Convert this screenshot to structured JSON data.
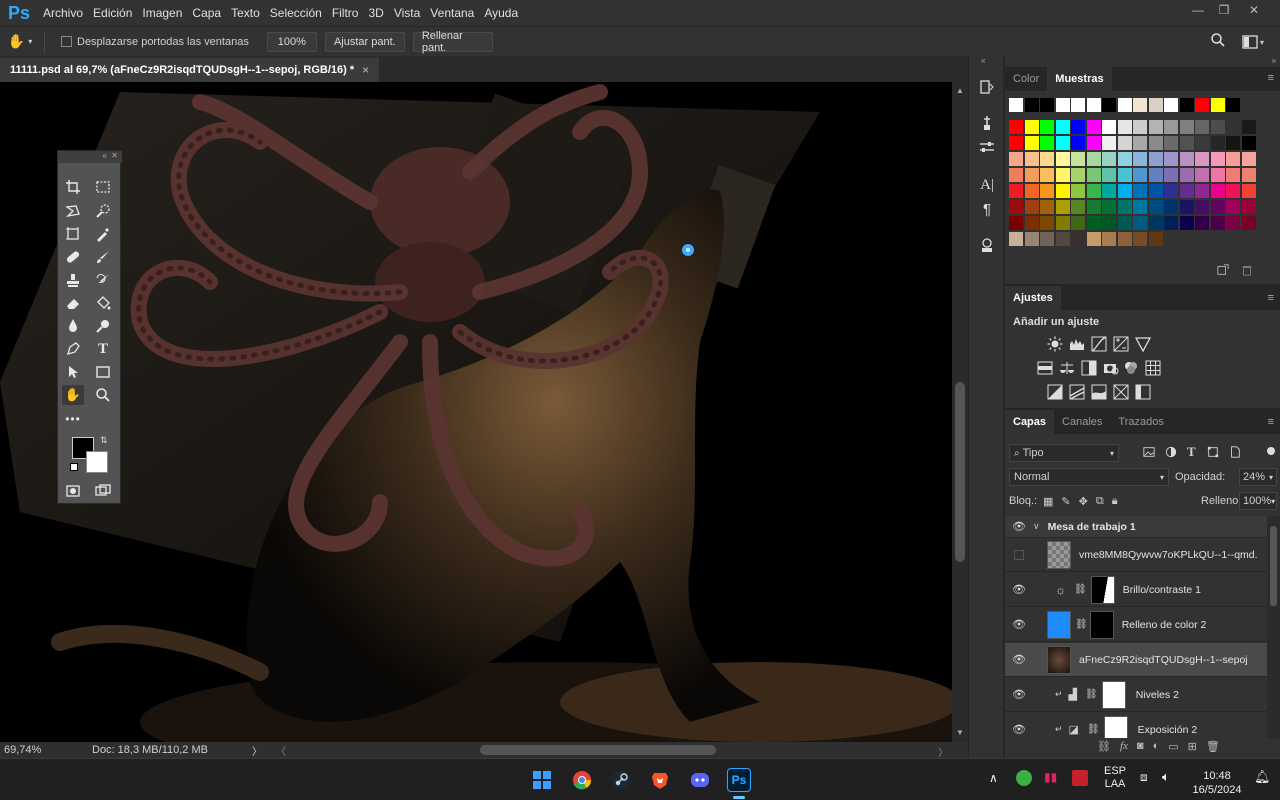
{
  "app": {
    "logo": "Ps"
  },
  "menu": [
    "Archivo",
    "Edición",
    "Imagen",
    "Capa",
    "Texto",
    "Selección",
    "Filtro",
    "3D",
    "Vista",
    "Ventana",
    "Ayuda"
  ],
  "options": {
    "scroll_all_label": "Desplazarse portodas las ventanas",
    "zoom_btn": "100%",
    "fit_btn": "Ajustar pant.",
    "fill_btn": "Rellenar pant."
  },
  "document": {
    "tab_title": "11111.psd al 69,7% (aFneCz9R2isqdTQUDsgH--1--sepoj, RGB/16) *",
    "close_glyph": "×"
  },
  "status": {
    "zoom": "69,74%",
    "doc": "Doc: 18,3 MB/110,2 MB"
  },
  "swatches_panel": {
    "tabs": [
      "Color",
      "Muestras"
    ],
    "active_tab": "Muestras",
    "row0": [
      "#ffffff",
      "#000000",
      "#000000",
      "#ffffff",
      "#ffffff",
      "#ffffff",
      "#000000",
      "#ffffff",
      "#f2e4cf",
      "#d9d0c4",
      "#ffffff",
      "#000000",
      "#ff0000",
      "#ffff00",
      "#000000"
    ],
    "rows": [
      [
        "#ff0000",
        "#ffff00",
        "#00ff00",
        "#00ffff",
        "#0000ff",
        "#ff00ff",
        "#ffffff",
        "#e6e6e6",
        "#cccccc",
        "#b3b3b3",
        "#999999",
        "#808080",
        "#666666",
        "#4d4d4d",
        "#333333",
        "#1a1a1a"
      ],
      [
        "#ff0000",
        "#ffff00",
        "#00ff00",
        "#00ffff",
        "#0000ff",
        "#ff00ff",
        "#f0f0f0",
        "#d4d4d4",
        "#a8a8a8",
        "#8a8a8a",
        "#6b6b6b",
        "#525252",
        "#3b3b3b",
        "#262626",
        "#141414",
        "#000000"
      ],
      [
        "#f4a58a",
        "#f8bf8c",
        "#fdd98f",
        "#fff799",
        "#c9e29c",
        "#a8d8a0",
        "#9ad3c3",
        "#8fd1e2",
        "#89b5dd",
        "#8f9fd1",
        "#a194c8",
        "#b992c3",
        "#d996c1",
        "#f29ab9",
        "#f49e95",
        "#f5a3a0"
      ],
      [
        "#f07e5c",
        "#f59c5d",
        "#fbbe5f",
        "#fff568",
        "#a9d26b",
        "#79c775",
        "#5dc4a9",
        "#4bc1d6",
        "#4f98cf",
        "#6380c0",
        "#7f6eb4",
        "#9d6bb0",
        "#c46fad",
        "#ee76a3",
        "#f07c73",
        "#f08070"
      ],
      [
        "#ee1c25",
        "#f26522",
        "#f7941d",
        "#fff200",
        "#8dc63f",
        "#39b54a",
        "#00a99d",
        "#00aeef",
        "#0072bc",
        "#0054a6",
        "#2e3192",
        "#662d91",
        "#92278f",
        "#ec008c",
        "#ed145b",
        "#ef4135"
      ],
      [
        "#9e0b0f",
        "#a0410d",
        "#a3620a",
        "#aba000",
        "#598527",
        "#197b30",
        "#007236",
        "#00746b",
        "#0076a3",
        "#004a80",
        "#003471",
        "#1b1464",
        "#440e62",
        "#630460",
        "#9e005d",
        "#9e0039"
      ],
      [
        "#790000",
        "#7b2e00",
        "#7d4900",
        "#827b00",
        "#406618",
        "#005e20",
        "#005826",
        "#005952",
        "#005b7f",
        "#003663",
        "#002157",
        "#0d004c",
        "#32004b",
        "#4b0049",
        "#7b0046",
        "#7a0026"
      ],
      [
        "#c7b299",
        "#998675",
        "#736357",
        "#534741",
        "#37302d",
        "#c69c6d",
        "#a67c52",
        "#8c6239",
        "#754c24",
        "#603913"
      ]
    ]
  },
  "adjustments": {
    "tab": "Ajustes",
    "add_label": "Añadir un ajuste"
  },
  "layers_panel": {
    "tabs": [
      "Capas",
      "Canales",
      "Trazados"
    ],
    "active_tab": "Capas",
    "filter_label": "Tipo",
    "blend_mode": "Normal",
    "opacity_label": "Opacidad:",
    "opacity_value": "24%",
    "lock_label": "Bloq.:",
    "fill_label": "Relleno:",
    "fill_value": "100%",
    "group_name": "Mesa de trabajo 1",
    "layers": [
      {
        "name": "vme8MM8Qywvw7oKPLkQU--1--qmd...",
        "visible": false
      },
      {
        "name": "Brillo/contraste 1",
        "visible": true
      },
      {
        "name": "Relleno de color 2",
        "visible": true
      },
      {
        "name": "aFneCz9R2isqdTQUDsgH--1--sepoj",
        "visible": true
      },
      {
        "name": "Niveles 2",
        "visible": true
      },
      {
        "name": "Exposición 2",
        "visible": true
      }
    ],
    "fill_color": "#1e8cff"
  },
  "taskbar": {
    "lang_top": "ESP",
    "lang_bottom": "LAA",
    "time": "10:48",
    "date": "16/5/2024",
    "ps_label": "Ps"
  }
}
